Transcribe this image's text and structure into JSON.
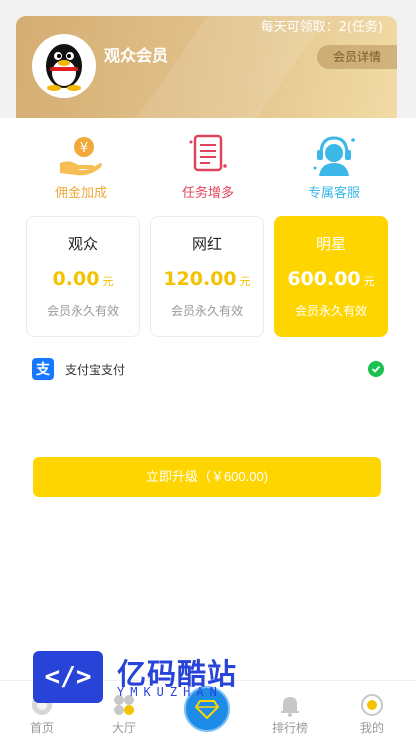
{
  "card": {
    "daily": "每天可领取：2(任务)",
    "title": "观众会员",
    "detail_button": "会员详情"
  },
  "benefits": [
    {
      "label": "佣金加成",
      "icon": "hand-coin-icon",
      "color": "#f0a93a"
    },
    {
      "label": "任务增多",
      "icon": "document-list-icon",
      "color": "#e0445b"
    },
    {
      "label": "专属客服",
      "icon": "customer-service-icon",
      "color": "#3bb7e8"
    }
  ],
  "plans": [
    {
      "name": "观众",
      "value": "0.00",
      "unit": "元",
      "validity": "会员永久有效",
      "selected": false
    },
    {
      "name": "网红",
      "value": "120.00",
      "unit": "元",
      "validity": "会员永久有效",
      "selected": false
    },
    {
      "name": "明星",
      "value": "600.00",
      "unit": "元",
      "validity": "会员永久有效",
      "selected": true
    }
  ],
  "payment": {
    "method": "支付宝支付",
    "icon": "alipay-icon",
    "selected": true
  },
  "upgrade_button": "立即升级（￥600.00)",
  "tabs": [
    {
      "label": "首页",
      "icon": "home-icon"
    },
    {
      "label": "大厅",
      "icon": "hall-icon"
    },
    {
      "label": "",
      "icon": "diamond-icon"
    },
    {
      "label": "排行榜",
      "icon": "bell-icon"
    },
    {
      "label": "我的",
      "icon": "user-icon"
    }
  ],
  "watermark": {
    "text": "亿码酷站",
    "sub": "YMKUZHAN",
    "logo": "</>"
  },
  "colors": {
    "accent": "#ffd500",
    "gold": "#d4ad72",
    "blue": "#1e8ce6",
    "check": "#18c050"
  }
}
